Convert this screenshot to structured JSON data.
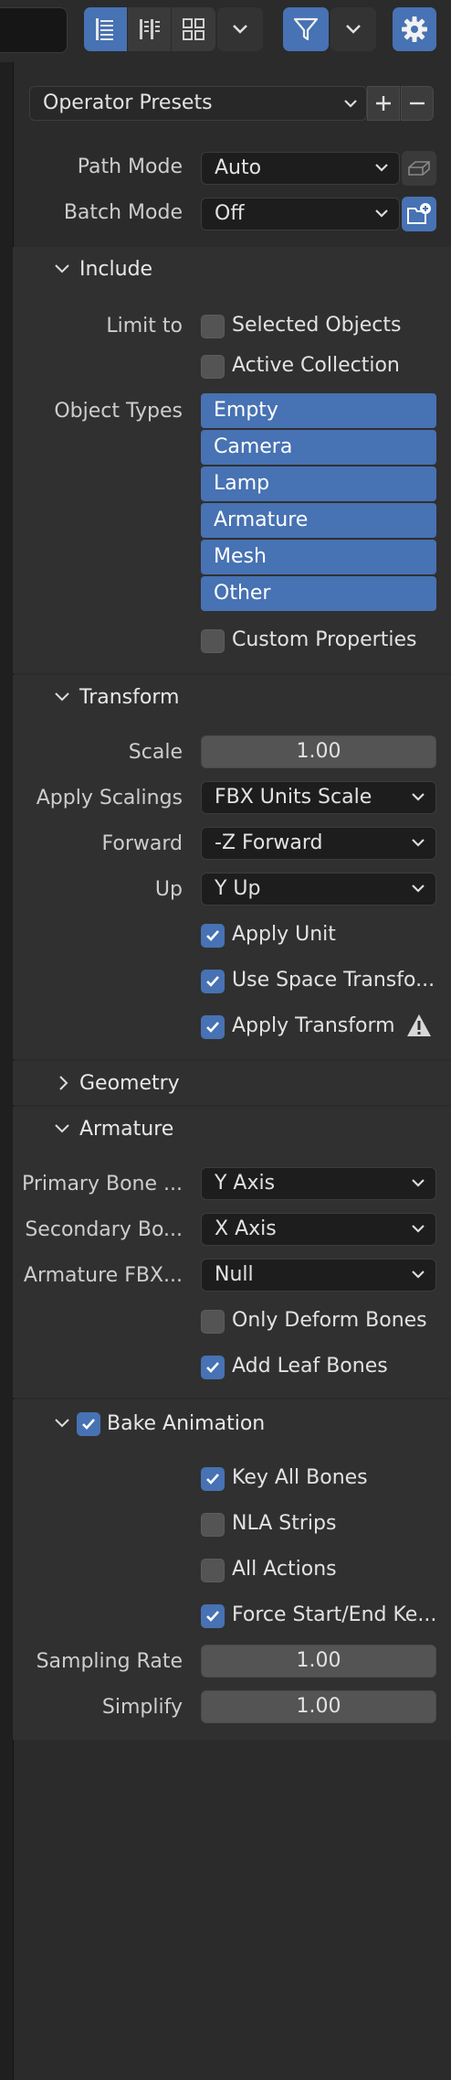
{
  "header": {
    "presets_label": "Operator Presets"
  },
  "path_mode": {
    "label": "Path Mode",
    "value": "Auto"
  },
  "batch_mode": {
    "label": "Batch Mode",
    "value": "Off"
  },
  "include": {
    "title": "Include",
    "limit_to_label": "Limit to",
    "selected_objects": "Selected Objects",
    "active_collection": "Active Collection",
    "object_types_label": "Object Types",
    "object_types": [
      "Empty",
      "Camera",
      "Lamp",
      "Armature",
      "Mesh",
      "Other"
    ],
    "custom_properties": "Custom Properties"
  },
  "transform": {
    "title": "Transform",
    "scale_label": "Scale",
    "scale_value": "1.00",
    "apply_scalings_label": "Apply Scalings",
    "apply_scalings_value": "FBX Units Scale",
    "forward_label": "Forward",
    "forward_value": "-Z Forward",
    "up_label": "Up",
    "up_value": "Y Up",
    "apply_unit": "Apply Unit",
    "use_space_transform": "Use Space Transfo...",
    "apply_transform": "Apply Transform"
  },
  "geometry": {
    "title": "Geometry"
  },
  "armature": {
    "title": "Armature",
    "primary_bone_label": "Primary Bone ...",
    "primary_bone_value": "Y Axis",
    "secondary_bone_label": "Secondary Bo...",
    "secondary_bone_value": "X Axis",
    "armature_fbx_label": "Armature FBX...",
    "armature_fbx_value": "Null",
    "only_deform_bones": "Only Deform Bones",
    "add_leaf_bones": "Add Leaf Bones"
  },
  "bake_animation": {
    "title": "Bake Animation",
    "key_all_bones": "Key All Bones",
    "nla_strips": "NLA Strips",
    "all_actions": "All Actions",
    "force_start_end": "Force Start/End Ke...",
    "sampling_rate_label": "Sampling Rate",
    "sampling_rate_value": "1.00",
    "simplify_label": "Simplify",
    "simplify_value": "1.00"
  },
  "colors": {
    "accent": "#4772b3",
    "panel": "#303030",
    "background": "#2b2b2b"
  }
}
